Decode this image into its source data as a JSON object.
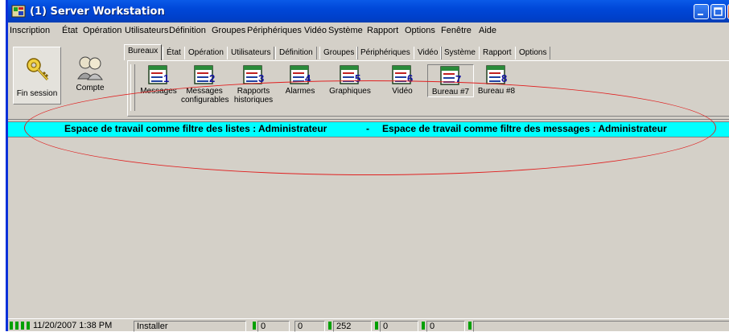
{
  "window": {
    "title": "(1) Server Workstation"
  },
  "menubar": [
    "Inscription",
    "État",
    "Opération",
    "Utilisateurs",
    "Définition",
    "Groupes",
    "Périphériques",
    "Vidéo",
    "Système",
    "Rapport",
    "Options",
    "Fenêtre",
    "Aide"
  ],
  "left_buttons": [
    {
      "label": "Fin session",
      "icon": "key-icon"
    },
    {
      "label": "Compte",
      "icon": "users-icon"
    }
  ],
  "tabs": [
    "Bureaux",
    "État",
    "Opération",
    "Utilisateurs",
    "Définition",
    "Groupes",
    "Périphériques",
    "Vidéo",
    "Système",
    "Rapport",
    "Options"
  ],
  "active_tab": "Bureaux",
  "desks": [
    {
      "num": "1",
      "label1": "Messages",
      "label2": ""
    },
    {
      "num": "2",
      "label1": "Messages",
      "label2": "configurables"
    },
    {
      "num": "3",
      "label1": "Rapports",
      "label2": "historiques"
    },
    {
      "num": "4",
      "label1": "Alarmes",
      "label2": ""
    },
    {
      "num": "5",
      "label1": "Graphiques",
      "label2": ""
    },
    {
      "num": "6",
      "label1": "Vidéo",
      "label2": ""
    },
    {
      "num": "7",
      "label1": "Bureau #7",
      "label2": ""
    },
    {
      "num": "8",
      "label1": "Bureau #8",
      "label2": ""
    }
  ],
  "workspace_bar": {
    "part1": "Espace de travail comme filtre des listes : Administrateur",
    "sep": "-",
    "part2": "Espace de travail comme filtre des messages : Administrateur"
  },
  "status": {
    "datetime": "11/20/2007 1:38 PM",
    "user": "Installer",
    "counters": [
      "0",
      "0",
      "252",
      "0",
      "0",
      ""
    ]
  },
  "colors": {
    "title_bar": "#0047d8",
    "workspace_bar": "#00ffff",
    "annotation": "#e02020",
    "led": "#00a000"
  }
}
